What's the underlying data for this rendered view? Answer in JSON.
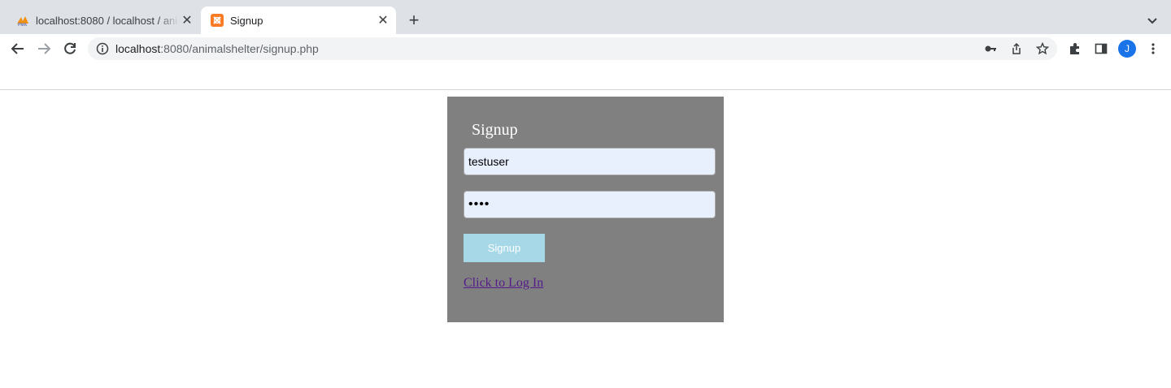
{
  "browser": {
    "tabs": [
      {
        "title": "localhost:8080 / localhost / animalshelter",
        "favicon": "phpmyadmin-icon",
        "close": "✕"
      },
      {
        "title": "Signup",
        "favicon": "xampp-icon",
        "close": "✕"
      }
    ],
    "new_tab": "+",
    "address": {
      "host": "localhost",
      "rest": ":8080/animalshelter/signup.php"
    },
    "avatar_letter": "J",
    "colors": {
      "tabstrip": "#dee1e6",
      "omnibox": "#f1f3f4",
      "avatar": "#1a73e8",
      "xampp": "#fb7a24"
    }
  },
  "signup": {
    "title": "Signup",
    "username_value": "testuser",
    "password_value": "••••",
    "button_label": "Signup",
    "login_link": "Click to Log In",
    "colors": {
      "panel": "#808080",
      "button": "#a6d8e7",
      "field": "#e8f0fe",
      "link": "#551a8b"
    }
  }
}
